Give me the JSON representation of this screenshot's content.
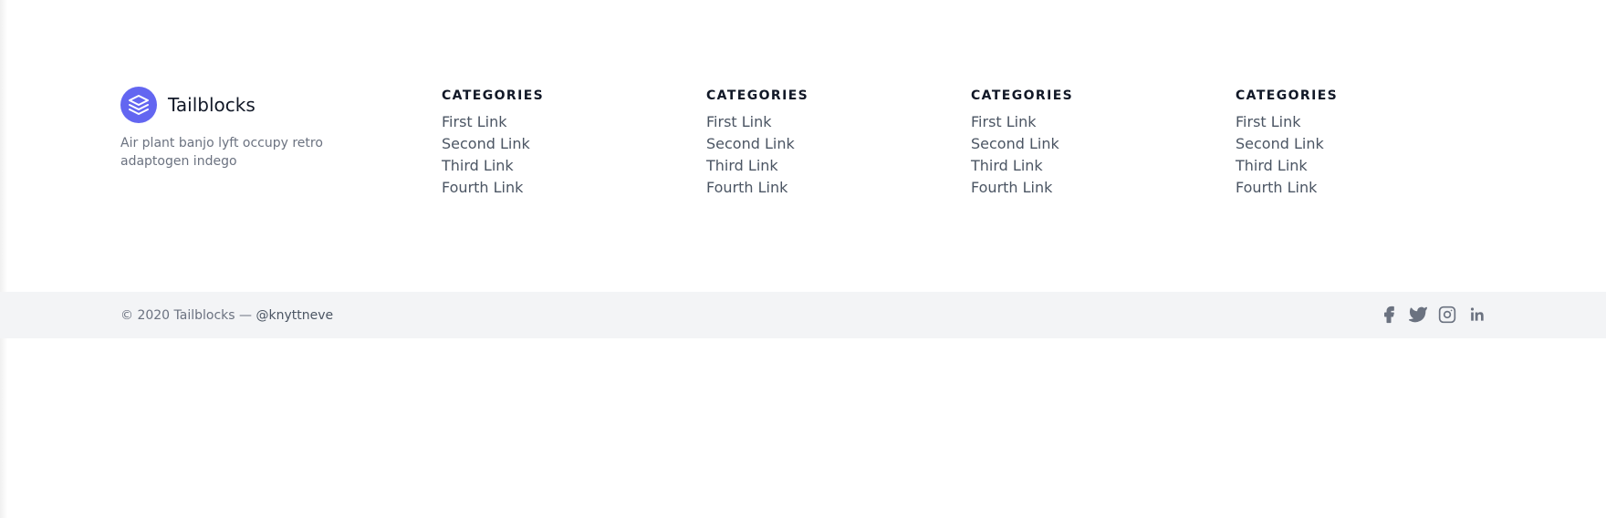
{
  "brand": {
    "name": "Tailblocks",
    "description": "Air plant banjo lyft occupy retro adaptogen indego",
    "logo_icon": "layers-icon",
    "accent_color": "#6366f1"
  },
  "columns": [
    {
      "title": "CATEGORIES",
      "links": [
        "First Link",
        "Second Link",
        "Third Link",
        "Fourth Link"
      ]
    },
    {
      "title": "CATEGORIES",
      "links": [
        "First Link",
        "Second Link",
        "Third Link",
        "Fourth Link"
      ]
    },
    {
      "title": "CATEGORIES",
      "links": [
        "First Link",
        "Second Link",
        "Third Link",
        "Fourth Link"
      ]
    },
    {
      "title": "CATEGORIES",
      "links": [
        "First Link",
        "Second Link",
        "Third Link",
        "Fourth Link"
      ]
    }
  ],
  "bottom_bar": {
    "copyright_prefix": "© 2020 Tailblocks — ",
    "handle": "@knyttneve",
    "background_color": "#f3f4f6",
    "social_icons": [
      "facebook-icon",
      "twitter-icon",
      "instagram-icon",
      "linkedin-icon"
    ]
  }
}
